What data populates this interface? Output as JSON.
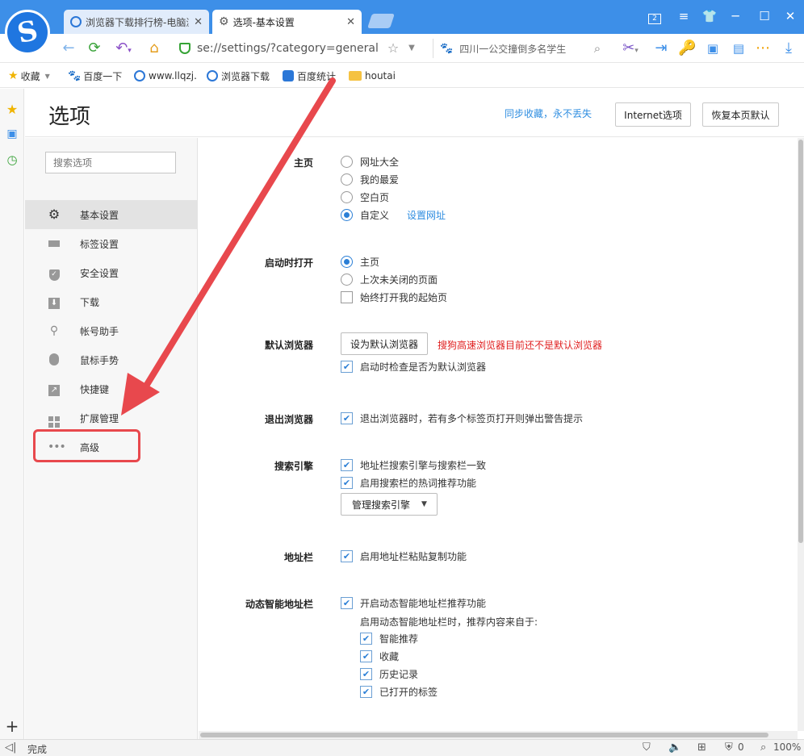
{
  "tabs": [
    {
      "label": "浏览器下载排行榜-电脑浏览器",
      "active": false
    },
    {
      "label": "选项-基本设置",
      "active": true
    }
  ],
  "address": {
    "url": "se://settings/?category=general",
    "search_placeholder": "四川一公交撞倒多名学生"
  },
  "bookmarks": [
    {
      "label": "收藏",
      "icon": "star-icon"
    },
    {
      "label": "百度一下",
      "icon": "baidu-icon"
    },
    {
      "label": "www.llqzj.",
      "icon": "globe-icon"
    },
    {
      "label": "浏览器下载",
      "icon": "globe-icon"
    },
    {
      "label": "百度统计",
      "icon": "baidu-tongji-icon"
    },
    {
      "label": "houtai",
      "icon": "folder-icon"
    }
  ],
  "header": {
    "title": "选项",
    "sync_link": "同步收藏，永不丢失",
    "internet_btn": "Internet选项",
    "restore_btn": "恢复本页默认"
  },
  "nav": {
    "search_placeholder": "搜索选项",
    "items": [
      {
        "label": "基本设置",
        "icon": "gear-icon",
        "active": true
      },
      {
        "label": "标签设置",
        "icon": "tab-icon"
      },
      {
        "label": "安全设置",
        "icon": "shield-icon"
      },
      {
        "label": "下载",
        "icon": "download-icon"
      },
      {
        "label": "帐号助手",
        "icon": "key-icon"
      },
      {
        "label": "鼠标手势",
        "icon": "mouse-icon"
      },
      {
        "label": "快捷键",
        "icon": "shortcut-icon"
      },
      {
        "label": "扩展管理",
        "icon": "extensions-icon"
      },
      {
        "label": "高级",
        "icon": "more-icon"
      }
    ]
  },
  "settings": {
    "homepage": {
      "label": "主页",
      "options": [
        "网址大全",
        "我的最爱",
        "空白页",
        "自定义"
      ],
      "selected": "自定义",
      "set_url_link": "设置网址"
    },
    "startup": {
      "label": "启动时打开",
      "options": [
        "主页",
        "上次未关闭的页面"
      ],
      "selected": "主页",
      "always_open": "始终打开我的起始页",
      "always_open_checked": false
    },
    "default_browser": {
      "label": "默认浏览器",
      "button": "设为默认浏览器",
      "warning": "搜狗高速浏览器目前还不是默认浏览器",
      "check_on_startup": "启动时检查是否为默认浏览器",
      "checked": true
    },
    "exit": {
      "label": "退出浏览器",
      "option": "退出浏览器时，若有多个标签页打开则弹出警告提示",
      "checked": true
    },
    "search_engine": {
      "label": "搜索引擎",
      "option1": "地址栏搜索引擎与搜索栏一致",
      "option2": "启用搜索栏的热词推荐功能",
      "manage_btn": "管理搜索引擎"
    },
    "addressbar": {
      "label": "地址栏",
      "option": "启用地址栏粘贴复制功能"
    },
    "smart_addressbar": {
      "label": "动态智能地址栏",
      "option": "开启动态智能地址栏推荐功能",
      "source_text": "启用动态智能地址栏时，推荐内容来自于:",
      "sources": [
        "智能推荐",
        "收藏",
        "历史记录",
        "已打开的标签"
      ]
    }
  },
  "status": {
    "text": "完成",
    "blocked_count": "0",
    "zoom": "100%"
  },
  "colors": {
    "accent": "#2b7fd6",
    "titlebar": "#3d8fe8",
    "warning": "#e02020",
    "annotation": "#e8484d"
  }
}
